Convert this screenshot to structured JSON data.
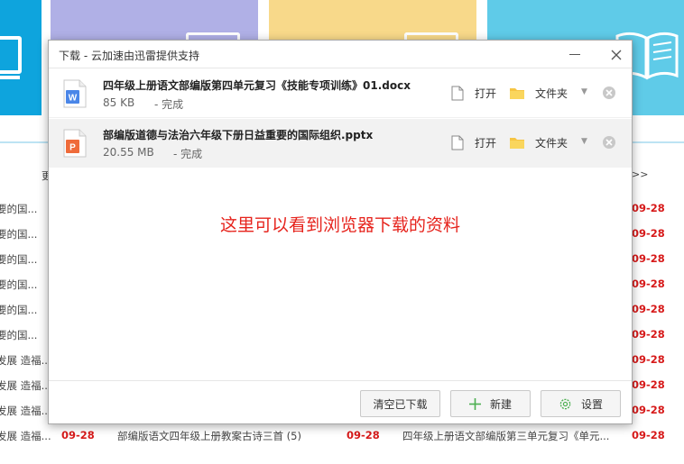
{
  "background": {
    "more_left": "更",
    "more_right": ">>",
    "rows": [
      {
        "left": "要的国...",
        "date": "09-28"
      },
      {
        "left": "要的国...",
        "date": "09-28"
      },
      {
        "left": "要的国...",
        "date": "09-28"
      },
      {
        "left": "要的国...",
        "date": "09-28"
      },
      {
        "left": "要的国...",
        "date": "09-28"
      },
      {
        "left": "要的国...",
        "date": "09-28"
      },
      {
        "left": "发展 造福...",
        "date": "09-28"
      },
      {
        "left": "发展 造福...",
        "date": "09-28"
      },
      {
        "left": "发展 造福...",
        "date": "09-28"
      }
    ],
    "last_row": {
      "left": "发展 造福...",
      "date1": "09-28",
      "title1": "部编版语文四年级上册教案古诗三首 (5)",
      "date2": "09-28",
      "title2": "四年级上册语文部编版第三单元复习《单元...",
      "date3": "09-28"
    }
  },
  "dialog": {
    "title": "下载 - 云加速由迅雷提供支持",
    "items": [
      {
        "name": "四年级上册语文部编版第四单元复习《技能专项训练》01.docx",
        "size": "85 KB",
        "status": "- 完成",
        "open": "打开",
        "folder": "文件夹",
        "type_letter": "W",
        "type_color": "#4a86e8"
      },
      {
        "name": "部编版道德与法治六年级下册日益重要的国际组织.pptx",
        "size": "20.55 MB",
        "status": "- 完成",
        "open": "打开",
        "folder": "文件夹",
        "type_letter": "P",
        "type_color": "#ef6b3a"
      }
    ],
    "hint": "这里可以看到浏览器下载的资料",
    "buttons": {
      "clear": "清空已下载",
      "new": "新建",
      "settings": "设置"
    }
  },
  "colors": {
    "accent_red": "#e6231c",
    "date_red": "#d71a1a",
    "plus_green": "#4caf50"
  }
}
